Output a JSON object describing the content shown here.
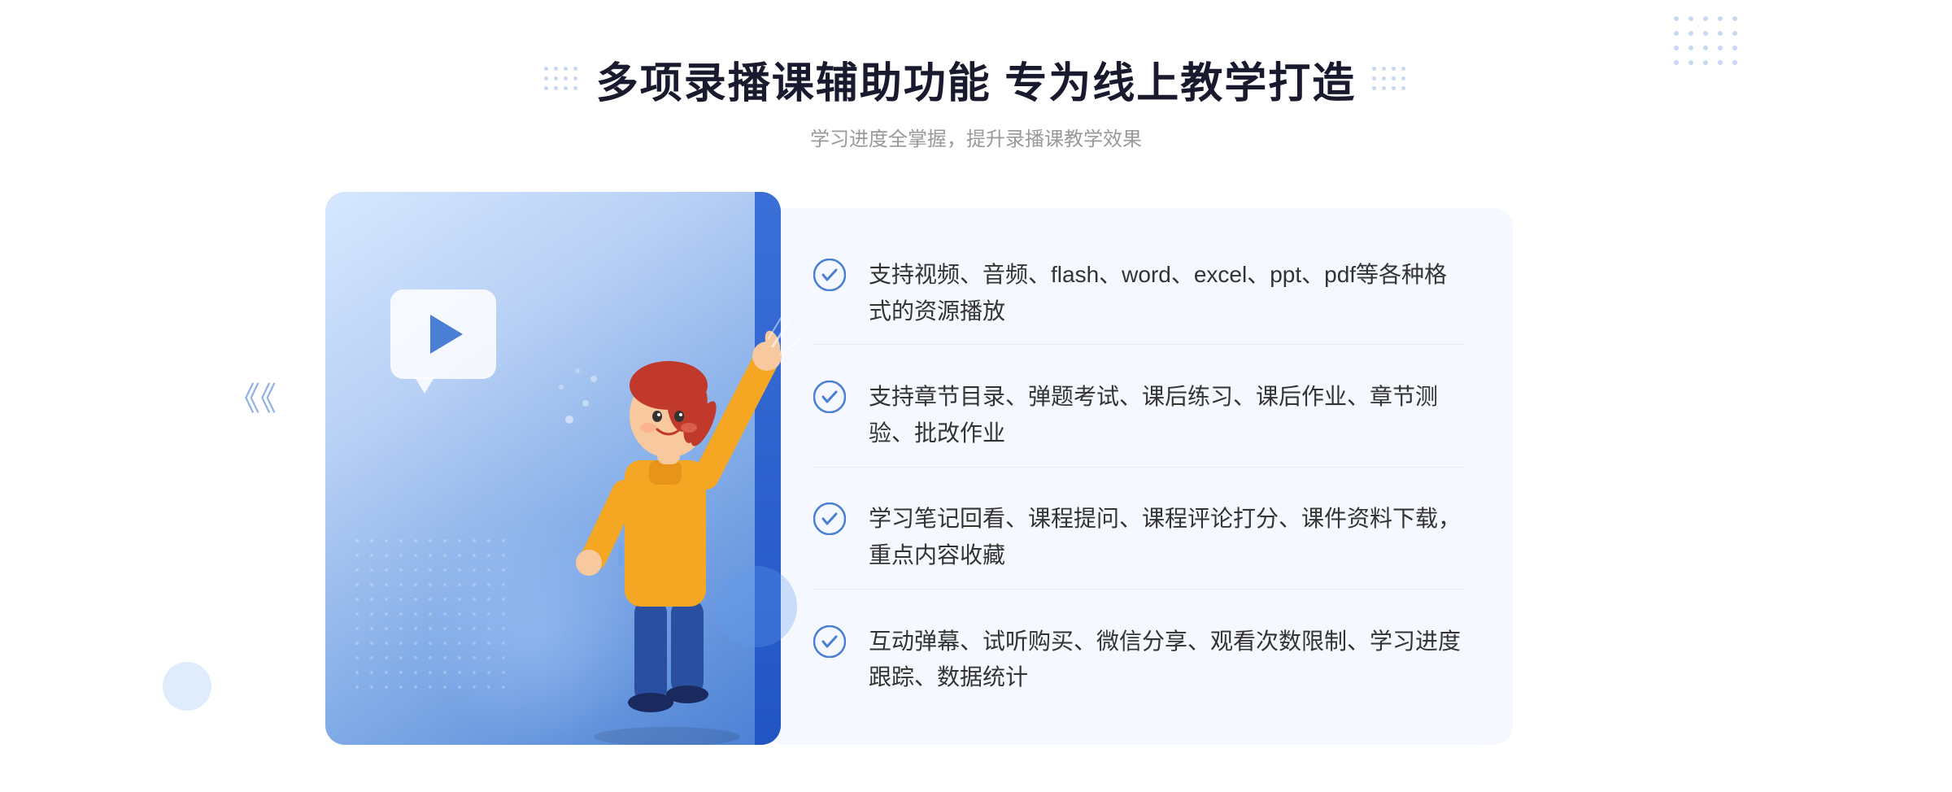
{
  "header": {
    "main_title": "多项录播课辅助功能 专为线上教学打造",
    "sub_title": "学习进度全掌握，提升录播课教学效果"
  },
  "features": [
    {
      "id": 1,
      "text": "支持视频、音频、flash、word、excel、ppt、pdf等各种格式的资源播放"
    },
    {
      "id": 2,
      "text": "支持章节目录、弹题考试、课后练习、课后作业、章节测验、批改作业"
    },
    {
      "id": 3,
      "text": "学习笔记回看、课程提问、课程评论打分、课件资料下载，重点内容收藏"
    },
    {
      "id": 4,
      "text": "互动弹幕、试听购买、微信分享、观看次数限制、学习进度跟踪、数据统计"
    }
  ],
  "colors": {
    "primary_blue": "#3a6fd8",
    "light_blue": "#85aee8",
    "text_dark": "#1a1a2e",
    "text_gray": "#999999",
    "text_body": "#333333",
    "bg_light": "#f5f8ff",
    "accent": "#4a7fd4"
  }
}
